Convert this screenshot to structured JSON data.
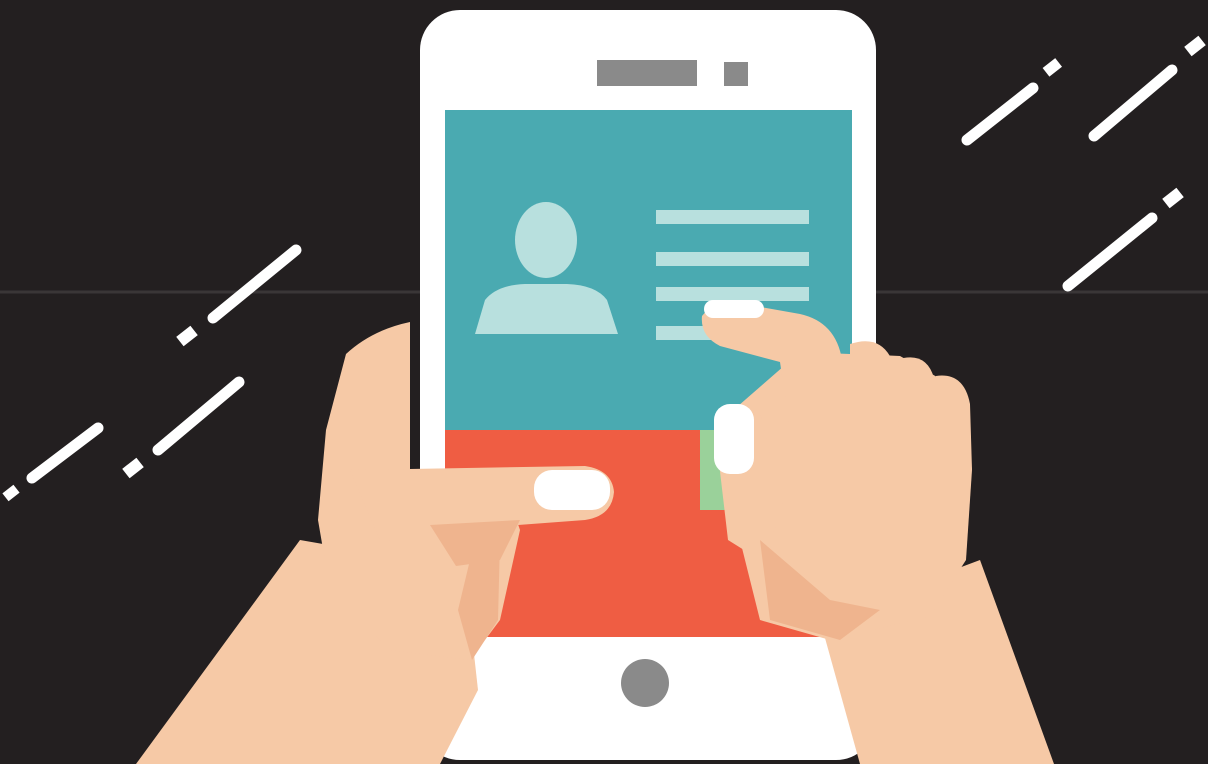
{
  "illustration": {
    "subject": "hands-holding-smartphone",
    "icons": {
      "profile": "user-avatar-icon",
      "speaker": "speaker-slot-icon",
      "camera": "front-camera-icon",
      "home": "home-button-icon"
    },
    "colors": {
      "background": "#231f20",
      "fold_crease": "#3a3637",
      "phone_body": "#ffffff",
      "speaker": "#8a8a8a",
      "screen_top": "#4aaab1",
      "screen_bottom": "#ef5d43",
      "screen_accent": "#9ad19a",
      "avatar": "#b8e0de",
      "text_lines": "#b8e0de",
      "home_button": "#8a8a8a",
      "skin": "#f6c9a6",
      "skin_shadow": "#efb48e",
      "nail": "#ffffff",
      "motion_lines": "#ffffff"
    }
  }
}
